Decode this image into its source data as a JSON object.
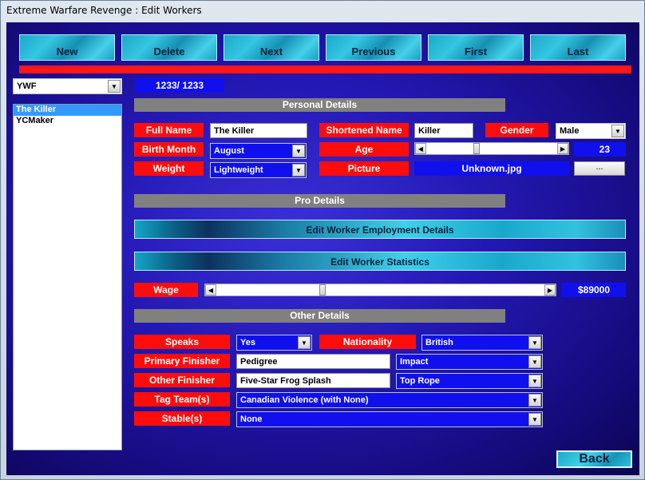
{
  "window": {
    "title": "Extreme Warfare Revenge : Edit Workers"
  },
  "nav": [
    "New",
    "Delete",
    "Next",
    "Previous",
    "First",
    "Last"
  ],
  "promotion_select": {
    "value": "YWF"
  },
  "counter": "1233/ 1233",
  "workers": [
    {
      "name": "The Killer",
      "selected": true
    },
    {
      "name": "YCMaker",
      "selected": false
    }
  ],
  "sections": {
    "personal": "Personal Details",
    "pro": "Pro Details",
    "other": "Other Details"
  },
  "personal": {
    "full_name_label": "Full Name",
    "full_name": "The Killer",
    "short_name_label": "Shortened Name",
    "short_name": "Killer",
    "gender_label": "Gender",
    "gender": "Male",
    "birth_month_label": "Birth Month",
    "birth_month": "August",
    "age_label": "Age",
    "age": "23",
    "age_slider_fraction": 0.38,
    "weight_label": "Weight",
    "weight": "Lightweight",
    "picture_label": "Picture",
    "picture": "Unknown.jpg",
    "browse_label": "..."
  },
  "pro": {
    "employment_button": "Edit Worker Employment Details",
    "statistics_button": "Edit Worker Statistics",
    "wage_label": "Wage",
    "wage": "$89000",
    "wage_slider_fraction": 0.32
  },
  "other": {
    "speaks_label": "Speaks",
    "speaks": "Yes",
    "nationality_label": "Nationality",
    "nationality": "British",
    "primary_finisher_label": "Primary Finisher",
    "primary_finisher": "Pedigree",
    "primary_finisher_type": "Impact",
    "other_finisher_label": "Other Finisher",
    "other_finisher": "Five-Star Frog Splash",
    "other_finisher_type": "Top Rope",
    "tag_team_label": "Tag Team(s)",
    "tag_team": "Canadian Violence (with None)",
    "stable_label": "Stable(s)",
    "stable": "None"
  },
  "back_label": "Back",
  "colors": {
    "label_red": "#ff0d0d",
    "field_blue": "#1010ee",
    "section_gray": "#808080",
    "accent_cyan": "#35c6e2"
  }
}
